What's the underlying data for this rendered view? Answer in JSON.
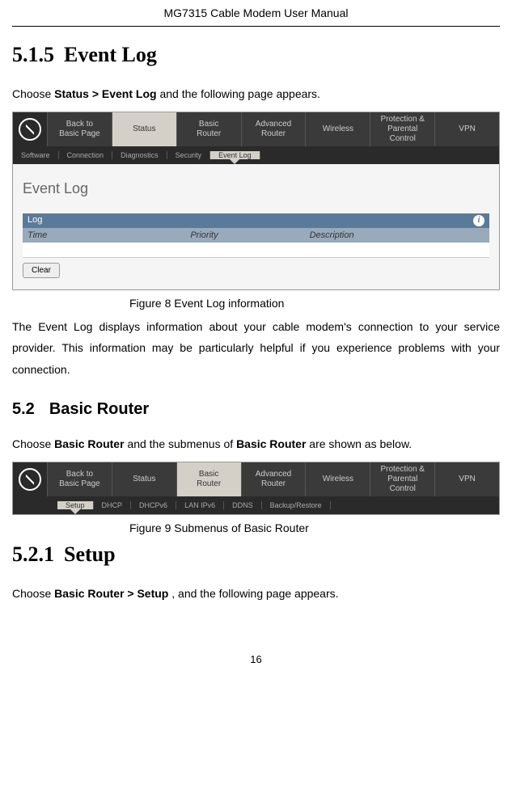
{
  "header": "MG7315 Cable Modem User Manual",
  "section_515": {
    "num": "5.1.5",
    "title": "Event Log",
    "intro_prefix": "Choose ",
    "intro_bold": "Status > Event Log",
    "intro_suffix": " and the following page appears."
  },
  "fig8": {
    "caption": "Figure 8 Event Log information",
    "nav": {
      "back": "Back to\nBasic Page",
      "status": "Status",
      "basic_router": "Basic\nRouter",
      "adv_router": "Advanced\nRouter",
      "wireless": "Wireless",
      "protection": "Protection &\nParental Control",
      "vpn": "VPN"
    },
    "subnav": {
      "software": "Software",
      "connection": "Connection",
      "diagnostics": "Diagnostics",
      "security": "Security",
      "eventlog": "Event Log"
    },
    "page_title": "Event Log",
    "log_label": "Log",
    "col_time": "Time",
    "col_priority": "Priority",
    "col_desc": "Description",
    "clear": "Clear"
  },
  "para1": "The Event Log displays information about your cable modem's connection to your service provider. This information may be particularly helpful if you experience problems with your connection.",
  "section_52": {
    "num": "5.2",
    "title": "Basic Router",
    "intro_prefix": "Choose ",
    "intro_bold1": "Basic Router",
    "intro_mid": " and the submenus of ",
    "intro_bold2": "Basic Router",
    "intro_suffix": " are shown as below."
  },
  "fig9": {
    "caption": "Figure 9 Submenus of Basic Router",
    "subnav": {
      "setup": "Setup",
      "dhcp": "DHCP",
      "dhcpv6": "DHCPv6",
      "lanipv6": "LAN IPv6",
      "ddns": "DDNS",
      "backup": "Backup/Restore"
    }
  },
  "section_521": {
    "num": "5.2.1",
    "title": "Setup",
    "intro_prefix": "Choose ",
    "intro_bold": "Basic Router > Setup",
    "intro_suffix": " , and the following page appears."
  },
  "page_number": "16"
}
